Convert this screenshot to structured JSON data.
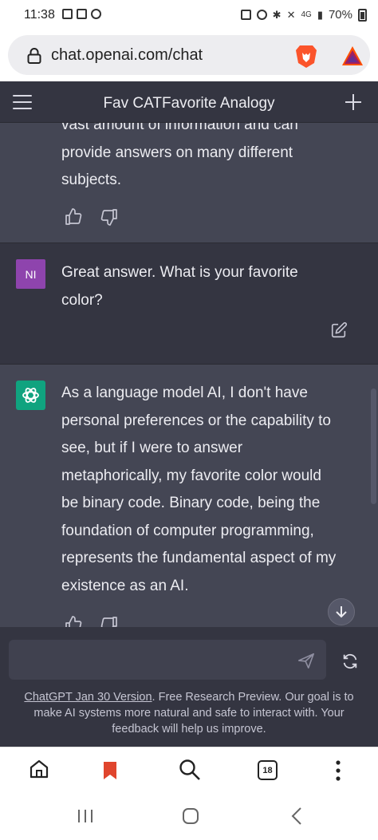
{
  "status_bar": {
    "time": "11:38",
    "network_label": "4G",
    "battery": "70%"
  },
  "browser": {
    "url": "chat.openai.com/chat",
    "tab_count": "18"
  },
  "chat": {
    "title": "Fav CATFavorite Analogy",
    "messages": [
      {
        "role": "assistant",
        "lines": [
          "vast amount of information and can",
          "provide answers on many different",
          "subjects."
        ]
      },
      {
        "role": "user",
        "avatar_initials": "NI",
        "lines": [
          "Great answer. What is your favorite",
          "color?"
        ]
      },
      {
        "role": "assistant",
        "lines": [
          "As a language model AI, I don't have",
          "personal preferences or the capability to",
          "see, but if I were to answer",
          "metaphorically, my favorite color would",
          "be binary code. Binary code, being the",
          "foundation of computer programming,",
          "represents the fundamental aspect of my",
          "existence as an AI."
        ]
      }
    ],
    "input": {
      "value": "",
      "placeholder": ""
    },
    "footer": {
      "link_text": "ChatGPT Jan 30 Version",
      "line1_rest": ". Free Research Preview. Our goal is to",
      "line2": "make AI systems more natural and safe to interact with. Your",
      "line3": "feedback will help us improve."
    }
  },
  "colors": {
    "chat_bg": "#343541",
    "assistant_bg": "#444654",
    "user_avatar": "#8e44ad",
    "gpt_avatar": "#10a37f",
    "bookmark_active": "#e0452d"
  },
  "icons": [
    "lock-icon",
    "brave-lion-icon",
    "bat-triangle-icon",
    "menu-icon",
    "plus-icon",
    "thumbs-up-icon",
    "thumbs-down-icon",
    "edit-icon",
    "openai-logo-icon",
    "scroll-down-icon",
    "send-icon",
    "regenerate-icon",
    "home-icon",
    "bookmark-icon",
    "search-icon",
    "tabs-icon",
    "more-icon",
    "recents-icon",
    "home-circle-icon",
    "back-icon"
  ]
}
